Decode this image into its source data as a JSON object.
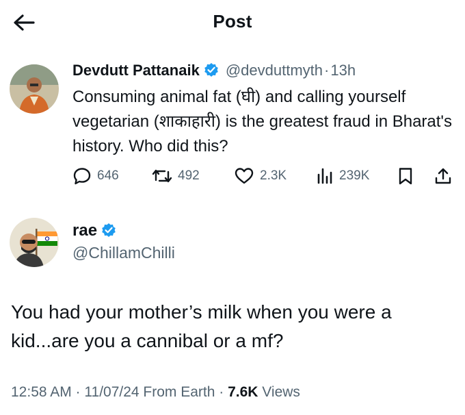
{
  "header": {
    "title": "Post"
  },
  "original_post": {
    "author_name": "Devdutt Pattanaik",
    "handle": "@devduttmyth",
    "separator": "·",
    "time": "13h",
    "text": "Consuming animal fat (घी) and calling yourself vegetarian (शाकाहारी) is the greatest fraud in Bharat's history. Who did this?",
    "actions": {
      "replies": "646",
      "reposts": "492",
      "likes": "2.3K",
      "views": "239K"
    }
  },
  "reply_post": {
    "author_name": "rae",
    "handle": "@ChillamChilli",
    "text": "You had your mother’s milk when you were a kid...are you a cannibal or a mf?",
    "timestamp": "12:58 AM · 11/07/24 From Earth · ",
    "views_count": "7.6K",
    "views_label": " Views"
  },
  "colors": {
    "verified": "#1d9bf0",
    "text": "#0f1419",
    "muted": "#536471"
  },
  "icons": [
    "back-arrow-icon",
    "verified-icon",
    "reply-icon",
    "repost-icon",
    "like-icon",
    "views-icon",
    "bookmark-icon",
    "share-icon"
  ]
}
